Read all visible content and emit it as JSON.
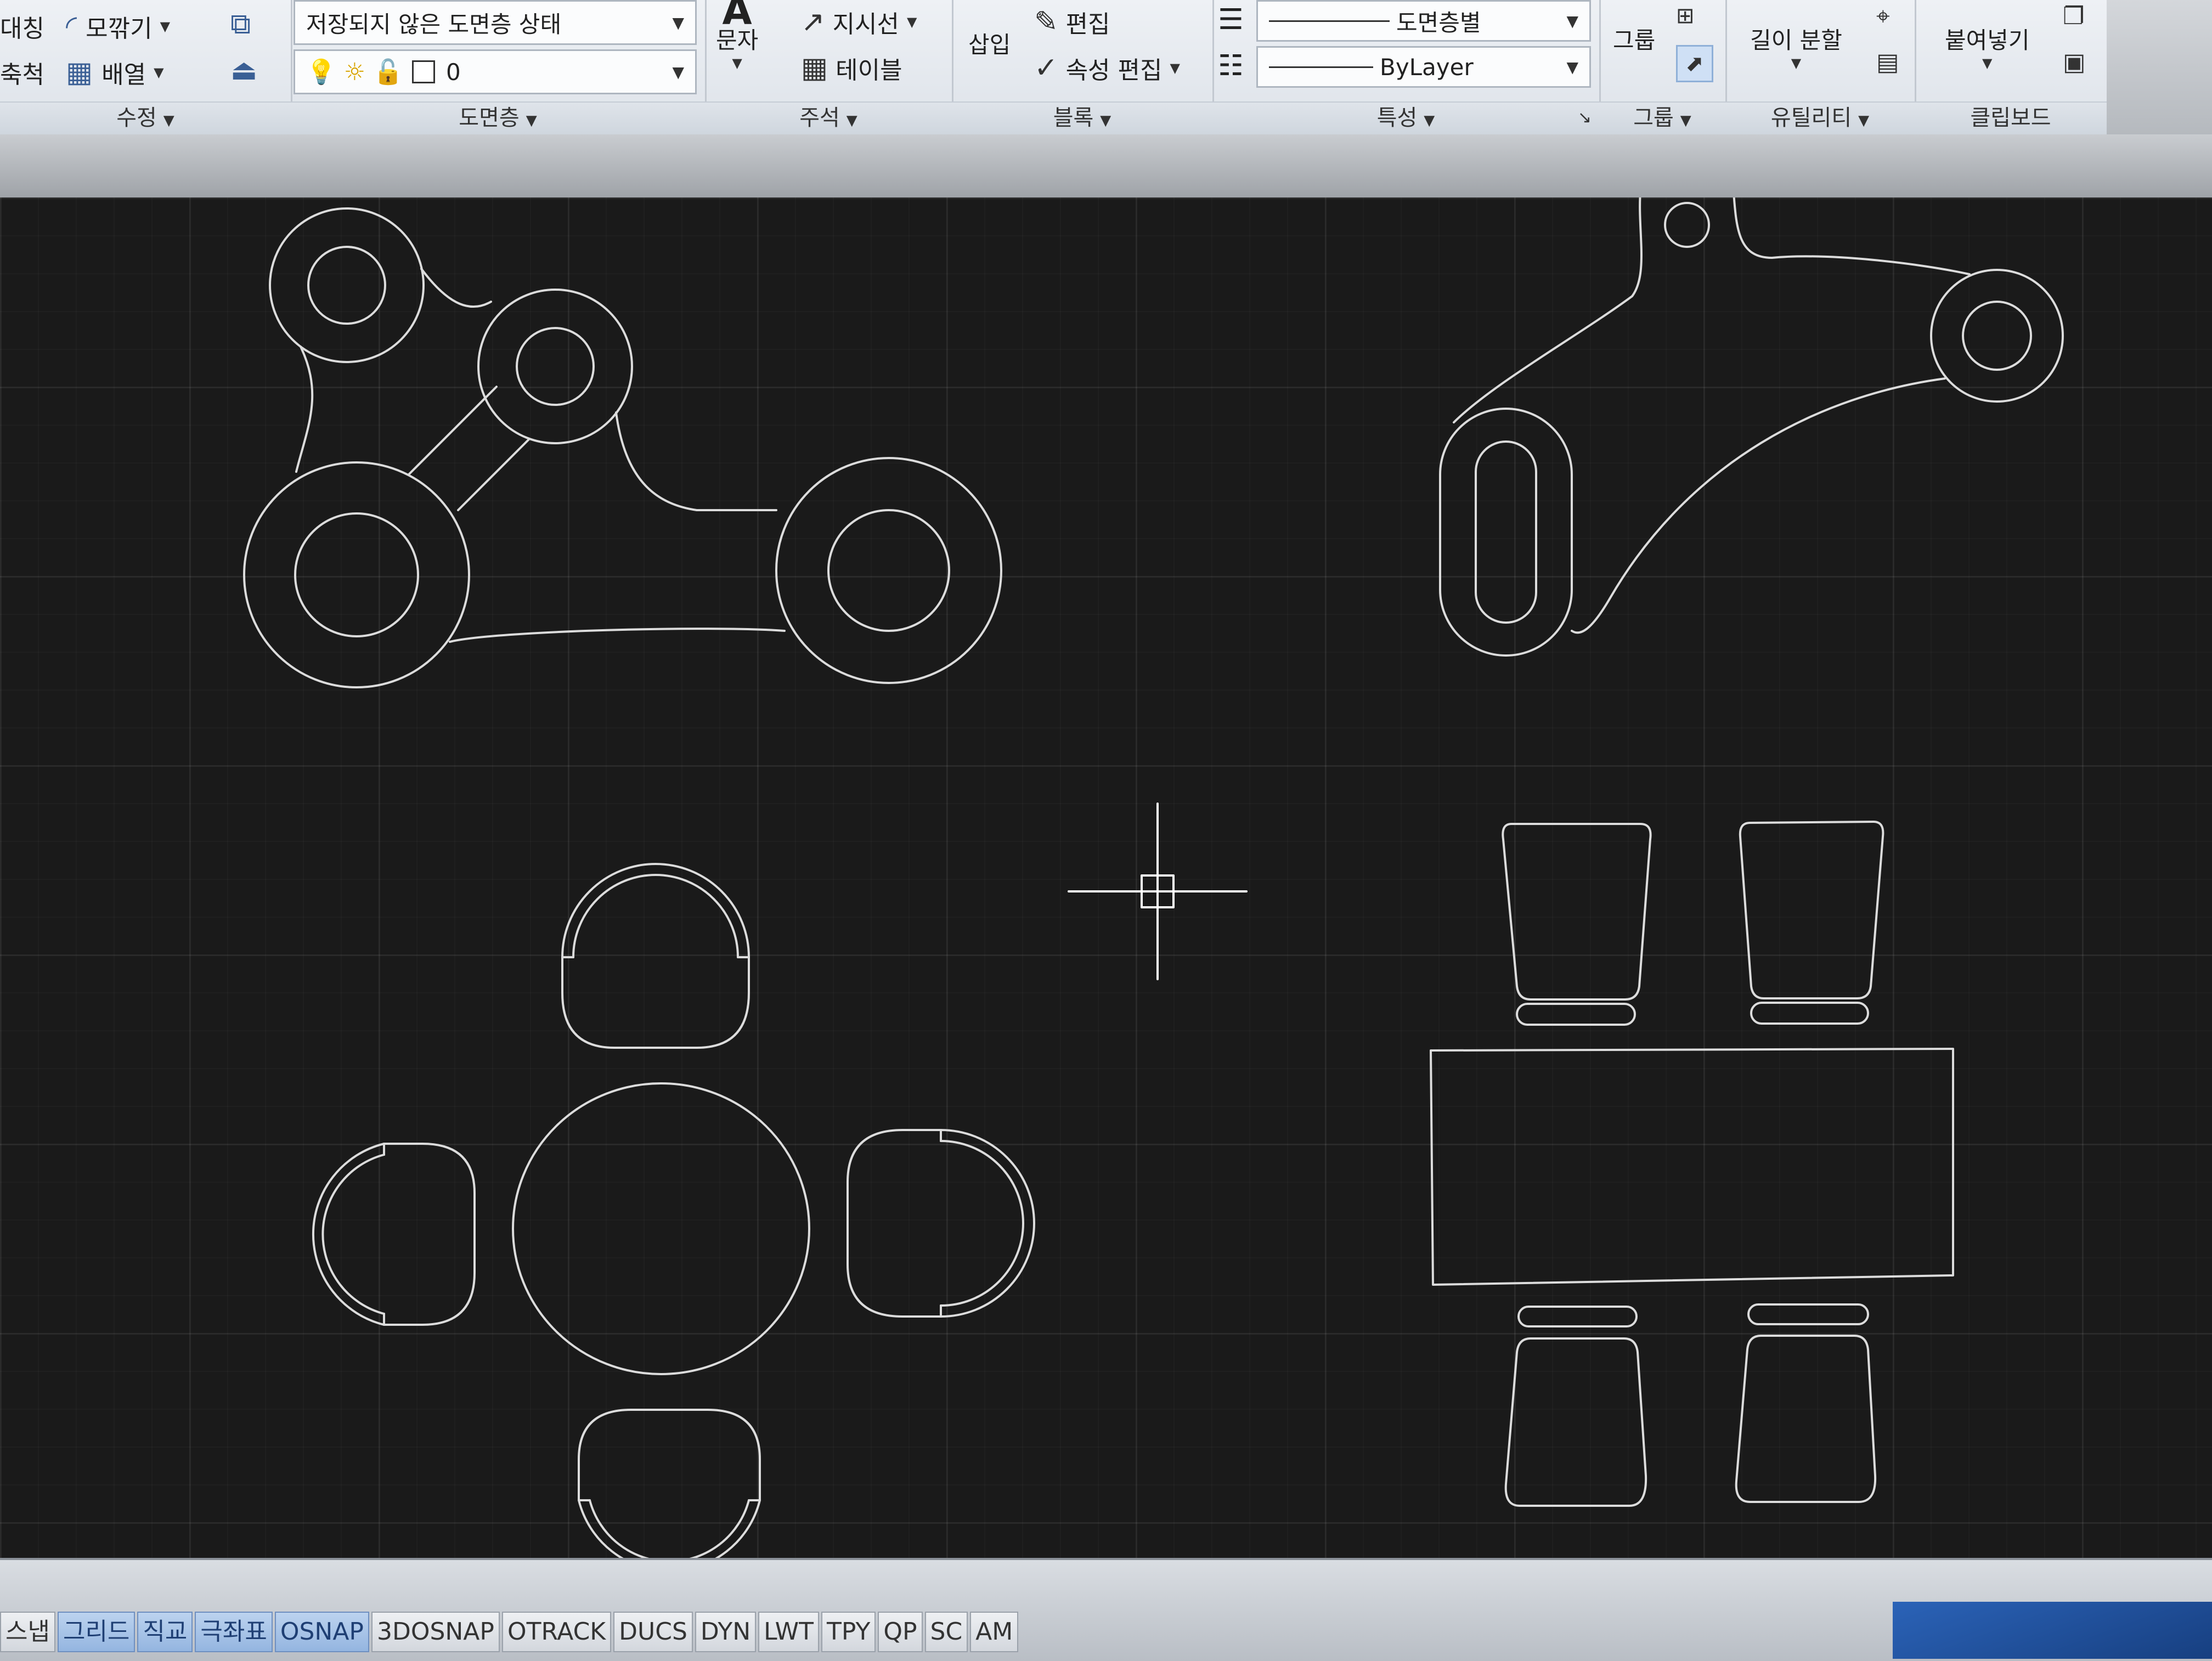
{
  "ribbon": {
    "modify": {
      "mirror_label": "대칭",
      "fillet_label": "모깎기",
      "scale_label": "축척",
      "array_label": "배열",
      "title": "수정"
    },
    "layers": {
      "state_value": "저장되지 않은 도면층 상태",
      "current_layer": "0",
      "title": "도면층"
    },
    "annotation": {
      "text_label": "문자",
      "leader_label": "지시선",
      "table_label": "테이블",
      "title": "주석"
    },
    "block": {
      "insert_label": "삽입",
      "edit_label": "편집",
      "attr_edit_label": "속성 편집",
      "title": "블록"
    },
    "properties": {
      "lineweight_value": "도면층별",
      "linetype_value": "ByLayer",
      "title": "특성"
    },
    "groups": {
      "group_label": "그룹",
      "title": "그룹"
    },
    "utilities": {
      "measure_label": "길이 분할",
      "title": "유틸리티"
    },
    "clipboard": {
      "paste_label": "붙여넣기",
      "title": "클립보드"
    }
  },
  "statusbar": {
    "buttons": [
      {
        "label": "스냅",
        "on": false
      },
      {
        "label": "그리드",
        "on": true
      },
      {
        "label": "직교",
        "on": true
      },
      {
        "label": "극좌표",
        "on": true
      },
      {
        "label": "OSNAP",
        "on": true
      },
      {
        "label": "3DOSNAP",
        "on": false
      },
      {
        "label": "OTRACK",
        "on": false
      },
      {
        "label": "DUCS",
        "on": false
      },
      {
        "label": "DYN",
        "on": false
      },
      {
        "label": "LWT",
        "on": false
      },
      {
        "label": "TPY",
        "on": false
      },
      {
        "label": "QP",
        "on": false
      },
      {
        "label": "SC",
        "on": false
      },
      {
        "label": "AM",
        "on": false
      }
    ]
  },
  "colors": {
    "canvas_bg": "#1a1a1a",
    "geometry": "#dcdcdc",
    "crosshair": "#ffffff",
    "ribbon_bg": "#e6eaef",
    "status_on": "#a9c4e8"
  }
}
